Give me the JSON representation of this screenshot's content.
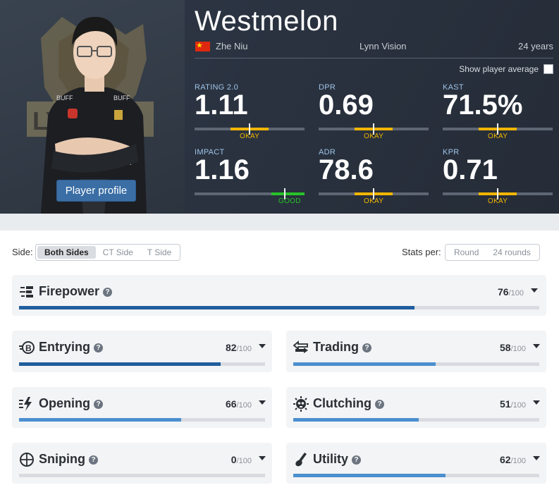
{
  "player": {
    "nickname": "Westmelon",
    "real_name": "Zhe Niu",
    "team": "Lynn Vision",
    "age": "24 years",
    "profile_button": "Player profile",
    "show_average_label": "Show player average",
    "show_average_checked": false,
    "team_logo_text": "LYNN",
    "jersey_sponsor": "BUFF"
  },
  "colors": {
    "okay": "#f2b600",
    "good": "#27c327",
    "bar_dark": "#1f5e9e",
    "bar_light": "#4a8fcf"
  },
  "stats": [
    {
      "label": "RATING 2.0",
      "value": "1.11",
      "rating": "OKAY",
      "fill": 0.5
    },
    {
      "label": "DPR",
      "value": "0.69",
      "rating": "OKAY",
      "fill": 0.5
    },
    {
      "label": "KAST",
      "value": "71.5%",
      "rating": "OKAY",
      "fill": 0.5
    },
    {
      "label": "IMPACT",
      "value": "1.16",
      "rating": "GOOD",
      "fill": 0.82
    },
    {
      "label": "ADR",
      "value": "78.6",
      "rating": "OKAY",
      "fill": 0.5
    },
    {
      "label": "KPR",
      "value": "0.71",
      "rating": "OKAY",
      "fill": 0.5
    }
  ],
  "filters": {
    "side_label": "Side:",
    "side_options": [
      "Both Sides",
      "CT Side",
      "T Side"
    ],
    "side_selected": "Both Sides",
    "stats_per_label": "Stats per:",
    "stats_per_options": [
      "Round",
      "24 rounds"
    ],
    "stats_per_selected": "Round"
  },
  "categories": [
    {
      "name": "Firepower",
      "icon": "firepower-icon",
      "score": 76,
      "max": "/100"
    },
    {
      "name": "Entrying",
      "icon": "entrying-icon",
      "score": 82,
      "max": "/100"
    },
    {
      "name": "Trading",
      "icon": "trading-icon",
      "score": 58,
      "max": "/100"
    },
    {
      "name": "Opening",
      "icon": "opening-icon",
      "score": 66,
      "max": "/100"
    },
    {
      "name": "Clutching",
      "icon": "clutching-icon",
      "score": 51,
      "max": "/100"
    },
    {
      "name": "Sniping",
      "icon": "sniping-icon",
      "score": 0,
      "max": "/100"
    },
    {
      "name": "Utility",
      "icon": "utility-icon",
      "score": 62,
      "max": "/100"
    }
  ]
}
